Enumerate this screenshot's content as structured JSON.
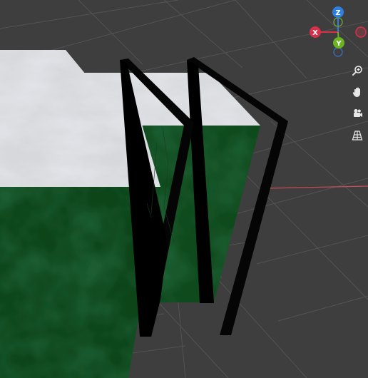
{
  "viewport": {
    "background": "#3e3e3e",
    "grid_color": "#525252",
    "x_axis_line_color": "#c94a57"
  },
  "objects": [
    {
      "name": "box-left",
      "top_material": "marble-white",
      "side_material": "dark-green"
    },
    {
      "name": "box-right",
      "top_material": "marble-white",
      "side_material": "dark-green"
    },
    {
      "name": "panel-front",
      "material": "black"
    },
    {
      "name": "panel-back",
      "material": "black"
    }
  ],
  "gizmo": {
    "axes": [
      {
        "id": "z",
        "label": "Z",
        "color": "#2f7fe0"
      },
      {
        "id": "x",
        "label": "X",
        "color": "#d9304a"
      },
      {
        "id": "y",
        "label": "Y",
        "color": "#6bb421"
      }
    ],
    "negative_axes": [
      {
        "id": "neg-z",
        "color": "#3a6aa8"
      },
      {
        "id": "neg-x",
        "color": "#b53a4a"
      },
      {
        "id": "neg-y",
        "color": "#5f8c33"
      }
    ]
  },
  "nav_tools": [
    {
      "id": "zoom",
      "icon": "zoom-icon"
    },
    {
      "id": "pan",
      "icon": "hand-icon"
    },
    {
      "id": "camera",
      "icon": "camera-icon"
    },
    {
      "id": "perspective",
      "icon": "grid-perspective-icon"
    }
  ]
}
